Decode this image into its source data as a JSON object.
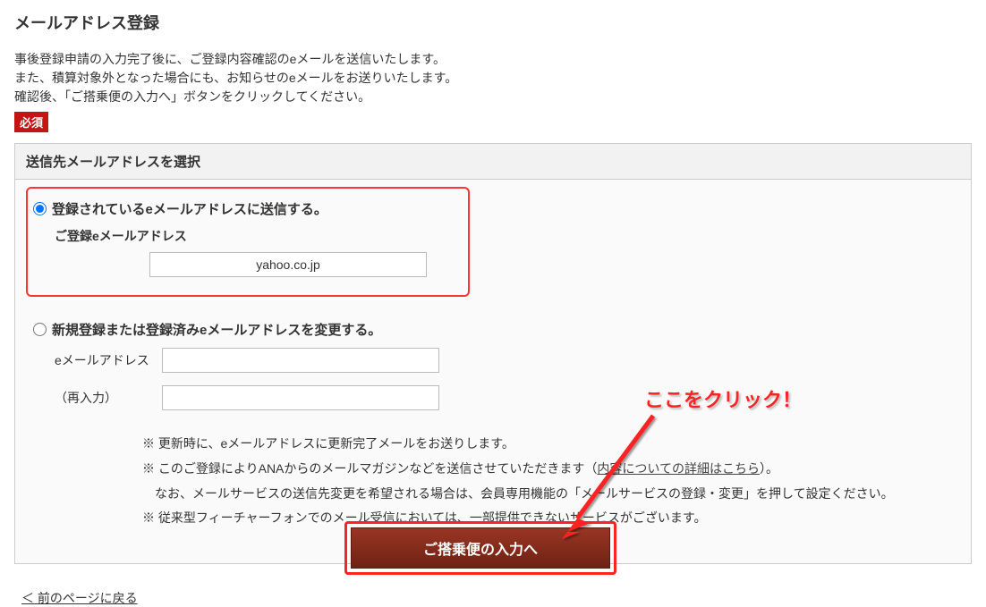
{
  "title": "メールアドレス登録",
  "intro": {
    "line1": "事後登録申請の入力完了後に、ご登録内容確認のeメールを送信いたします。",
    "line2": "また、積算対象外となった場合にも、お知らせのeメールをお送りいたします。",
    "line3": "確認後、「ご搭乗便の入力へ」ボタンをクリックしてください。"
  },
  "required_label": "必須",
  "panel_header": "送信先メールアドレスを選択",
  "option1": {
    "label": "登録されているeメールアドレスに送信する。",
    "sublabel": "ご登録eメールアドレス",
    "value": "yahoo.co.jp",
    "checked": true
  },
  "option2": {
    "label": "新規登録または登録済みeメールアドレスを変更する。",
    "field1_label": "eメールアドレス",
    "field1_value": "",
    "field2_label": "（再入力）",
    "field2_value": "",
    "checked": false
  },
  "notes": {
    "n1": "※ 更新時に、eメールアドレスに更新完了メールをお送りします。",
    "n2_pre": "※ このご登録によりANAからのメールマガジンなどを送信させていただきます（",
    "n2_link": "内容についての詳細はこちら",
    "n2_post": "）。",
    "n2_indent": "なお、メールサービスの送信先変更を希望される場合は、会員専用機能の「メールサービスの登録・変更」を押して設定ください。",
    "n3": "※ 従来型フィーチャーフォンでのメール受信においては、一部提供できないサービスがございます。"
  },
  "back_link": "＜ 前のページに戻る",
  "primary_button": "ご搭乗便の入力へ",
  "callout": "ここをクリック！"
}
